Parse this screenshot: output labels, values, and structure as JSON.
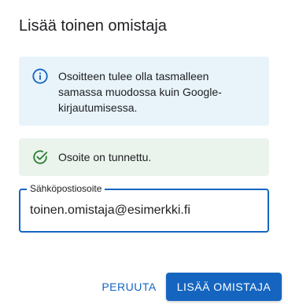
{
  "dialog": {
    "title": "Lisää toinen omistaja"
  },
  "info_message": {
    "icon": "info-icon",
    "text": "Osoitteen tulee olla tasmalleen samassa muodossa kuin Google-kirjautumisessa.",
    "color": "#1565c0",
    "background": "#e8f4fa"
  },
  "success_message": {
    "icon": "check-circle-icon",
    "text": "Osoite on tunnettu.",
    "color": "#2e7d32",
    "background": "#eaf3ec"
  },
  "email_field": {
    "label": "Sähköpostiosoite",
    "value": "toinen.omistaja@esimerkki.fi"
  },
  "actions": {
    "cancel_label": "PERUUTA",
    "submit_label": "LISÄÄ OMISTAJA"
  },
  "colors": {
    "accent": "#1565c0"
  }
}
